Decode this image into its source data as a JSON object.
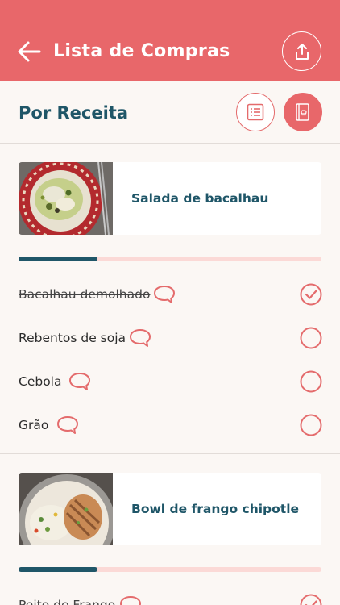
{
  "header": {
    "title": "Lista de Compras",
    "background": "#e8676a"
  },
  "icons": {
    "back": "arrow-left-icon",
    "share": "share-icon",
    "list_view": "list-icon",
    "recipe_view": "recipe-book-icon",
    "comment": "comment-icon",
    "check": "check-icon"
  },
  "subheader": {
    "title": "Por Receita"
  },
  "colors": {
    "accent": "#e8676a",
    "primary_text": "#1f5668",
    "progress_track": "#fbd9d6",
    "progress_fill": "#1f5668"
  },
  "recipes": [
    {
      "name": "Salada de bacalhau",
      "progress": 0.26,
      "items": [
        {
          "label": "Bacalhau demolhado",
          "checked": true
        },
        {
          "label": "Rebentos de soja",
          "checked": false
        },
        {
          "label": "Cebola",
          "checked": false
        },
        {
          "label": "Grão",
          "checked": false
        }
      ]
    },
    {
      "name": "Bowl de frango chipotle",
      "progress": 0.26,
      "items": [
        {
          "label": "Peito de Frango",
          "checked": true
        }
      ]
    }
  ]
}
